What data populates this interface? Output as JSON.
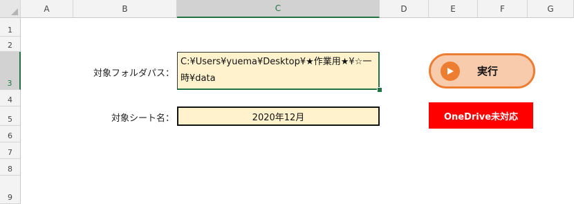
{
  "columns": [
    "A",
    "B",
    "C",
    "D",
    "E",
    "F",
    "G"
  ],
  "rows": [
    "1",
    "2",
    "3",
    "4",
    "5",
    "6",
    "7",
    "8",
    "9"
  ],
  "selected": {
    "column": "C",
    "row": "3"
  },
  "form": {
    "folder_label": "対象フォルダパス：",
    "folder_value": "C:¥Users¥yuema¥Desktop¥★作業用★¥☆一時¥data",
    "sheet_label": "対象シート名：",
    "sheet_value": "2020年12月"
  },
  "actions": {
    "run_label": "実行",
    "onedrive_notice": "OneDrive未対応"
  },
  "colors": {
    "input_fill": "#fff2cc",
    "button_fill": "#f8cbad",
    "button_accent": "#ed7d31",
    "notice_fill": "#ff0000",
    "selection": "#217346"
  },
  "icons": {
    "run": "play-circle-icon"
  }
}
